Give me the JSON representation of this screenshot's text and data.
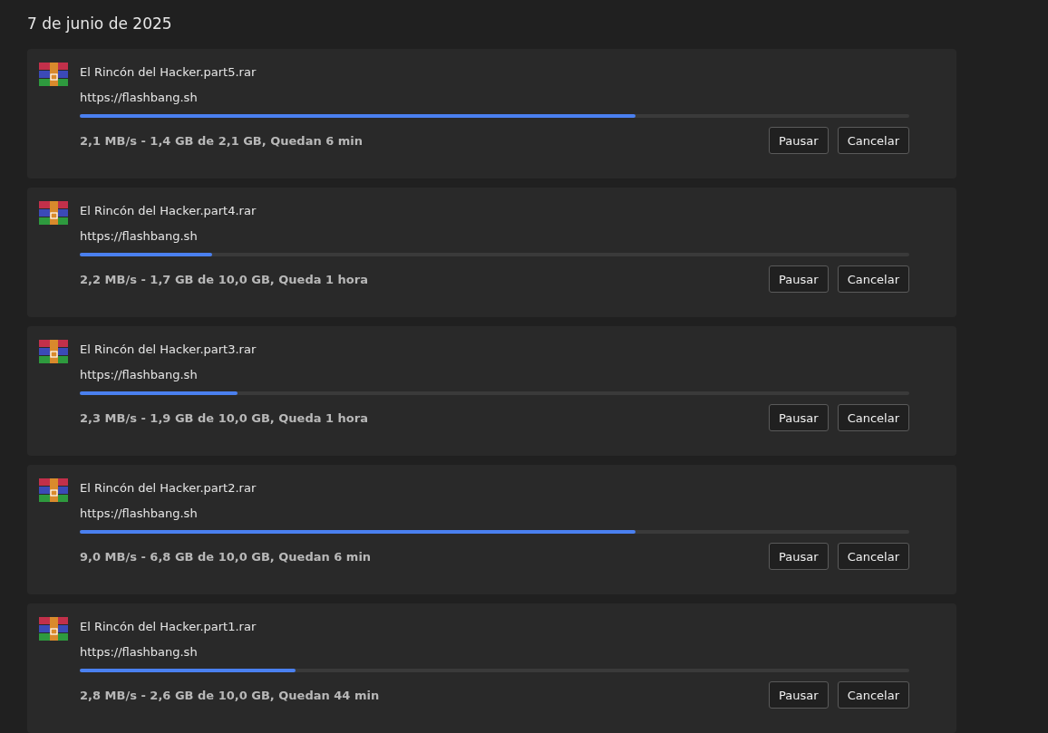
{
  "date_heading": "7 de junio de 2025",
  "downloads": [
    {
      "name": "El Rincón del Hacker.part5.rar",
      "url": "https://flashbang.sh",
      "level": 0.67,
      "status": "2,1 MB/s - 1,4 GB de 2,1 GB, Quedan 6 min",
      "buttons": [
        "Pausar",
        "Cancelar"
      ]
    },
    {
      "name": "El Rincón del Hacker.part4.rar",
      "url": "https://flashbang.sh",
      "level": 0.16,
      "status": "2,2 MB/s - 1,7 GB de 10,0 GB, Queda 1 hora",
      "buttons": [
        "Pausar",
        "Cancelar"
      ]
    },
    {
      "name": "El Rincón del Hacker.part3.rar",
      "url": "https://flashbang.sh",
      "level": 0.19,
      "status": "2,3 MB/s - 1,9 GB de 10,0 GB, Queda 1 hora",
      "buttons": [
        "Pausar",
        "Cancelar"
      ]
    },
    {
      "name": "El Rincón del Hacker.part2.rar",
      "url": "https://flashbang.sh",
      "level": 0.67,
      "status": "9,0 MB/s - 6,8 GB de 10,0 GB, Quedan 6 min",
      "buttons": [
        "Pausar",
        "Cancelar"
      ]
    },
    {
      "name": "El Rincón del Hacker.part1.rar",
      "url": "https://flashbang.sh",
      "level": 0.26,
      "status": "2,8 MB/s - 2,6 GB de 10,0 GB, Quedan 44 min",
      "buttons": [
        "Pausar",
        "Cancelar"
      ]
    }
  ]
}
